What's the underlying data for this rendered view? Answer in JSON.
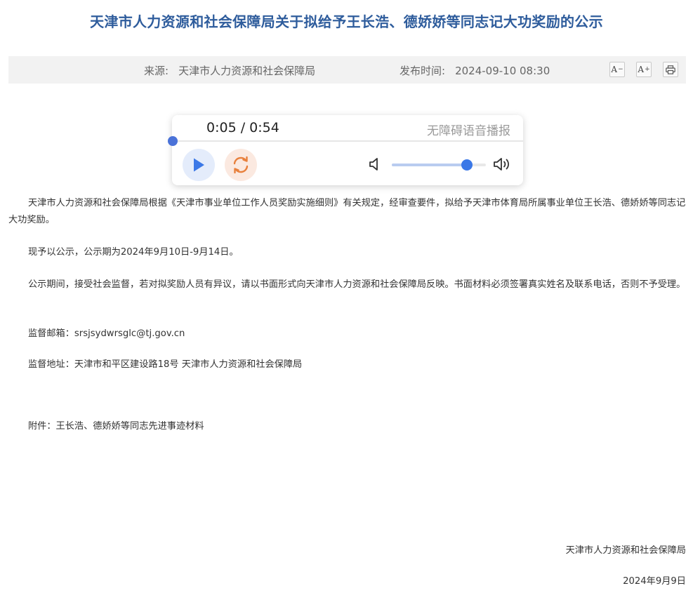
{
  "article": {
    "title": "天津市人力资源和社会保障局关于拟给予王长浩、德娇娇等同志记大功奖励的公示"
  },
  "meta": {
    "source_label": "来源:",
    "source_value": "天津市人力资源和社会保障局",
    "time_label": "发布时间:",
    "time_value": "2024-09-10 08:30"
  },
  "toolbar": {
    "font_decrease": "A",
    "font_decrease_sup": "−",
    "font_increase": "A",
    "font_increase_sup": "+",
    "print_icon": "printer-icon"
  },
  "audio_player": {
    "time_display": "0:05 / 0:54",
    "label": "无障碍语音播报",
    "progress": 0.0926,
    "volume": 0.8,
    "play_icon": "play-icon",
    "replay_icon": "replay-icon",
    "accent_color": "#3b78e7",
    "replay_color": "#e8803c"
  },
  "body": {
    "paragraph1": "天津市人力资源和社会保障局根据《天津市事业单位工作人员奖励实施细则》有关规定，经审查要件，拟给予天津市体育局所属事业单位王长浩、德娇娇等同志记大功奖励。",
    "paragraph2": "现予以公示，公示期为2024年9月10日-9月14日。",
    "paragraph3": "公示期间，接受社会监督，若对拟奖励人员有异议，请以书面形式向天津市人力资源和社会保障局反映。书面材料必须签署真实姓名及联系电话，否则不予受理。",
    "paragraph4": "监督邮箱：srsjsydwrsglc@tj.gov.cn",
    "paragraph5": "监督地址：天津市和平区建设路18号 天津市人力资源和社会保障局",
    "attachment": "附件：王长浩、德娇娇等同志先进事迹材料"
  },
  "signature": {
    "organization": "天津市人力资源和社会保障局",
    "date": "2024年9月9日"
  }
}
